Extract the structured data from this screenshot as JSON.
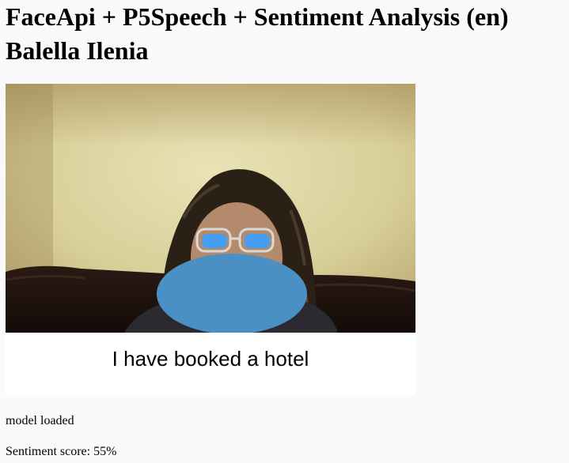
{
  "header": {
    "title_line1": "FaceApi + P5Speech + Sentiment Analysis (en)",
    "title_line2": "Balella Ilenia"
  },
  "canvas": {
    "recognized_speech": "I have booked a hotel",
    "face_overlay_color": "#4a90c4"
  },
  "status": {
    "model_status": "model loaded",
    "sentiment_label": "Sentiment score: 55%",
    "sentiment_score_percent": 55
  }
}
